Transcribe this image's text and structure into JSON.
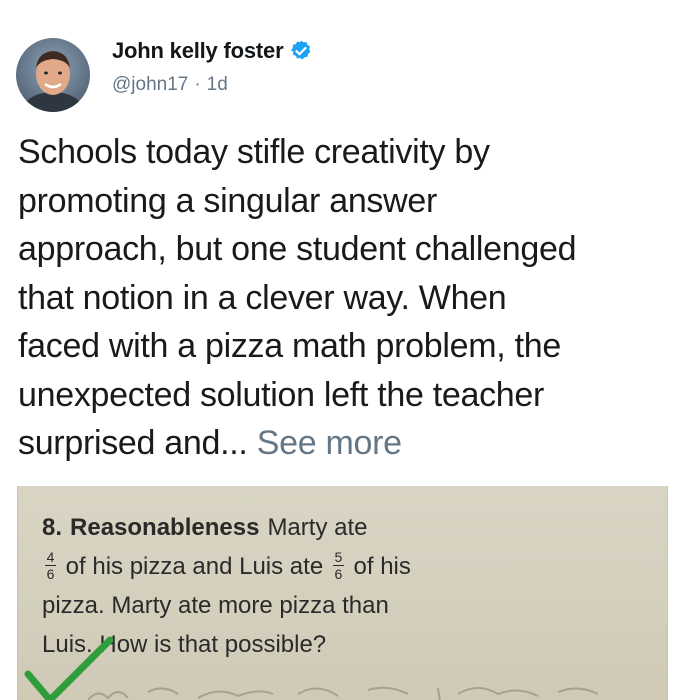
{
  "author": {
    "display_name": "John kelly foster",
    "handle": "@john17",
    "separator": "·",
    "age": "1d",
    "verified": true,
    "avatar_icon": "avatar-photo",
    "verified_icon": "verified-badge-icon",
    "verified_color": "#1da1f2"
  },
  "tweet": {
    "lines": [
      "Schools today stifle creativity by",
      "promoting a singular answer",
      "approach, but one student challenged",
      "that notion in a clever way. When",
      "faced with a pizza math problem, the",
      "unexpected solution left the teacher",
      "surprised and..."
    ],
    "see_more": "See more",
    "see_more_color": "#657786"
  },
  "media": {
    "question_number": "8.",
    "question_title": "Reasonableness",
    "text_part1": "Marty ate",
    "frac1_num": "4",
    "frac1_den": "6",
    "text_part2": "of his pizza and Luis ate",
    "frac2_num": "5",
    "frac2_den": "6",
    "text_part3": "of his",
    "text_line3": "pizza. Marty ate more pizza than",
    "text_line4": "Luis. How is that possible?",
    "check_color": "#2f9e3a"
  }
}
